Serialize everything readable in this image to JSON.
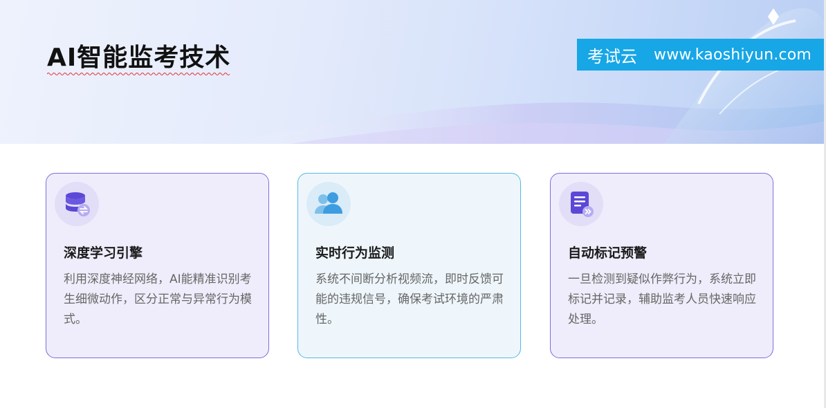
{
  "header": {
    "title": "AI智能监考技术"
  },
  "brand": {
    "name": "考试云",
    "url": "www.kaoshiyun.com",
    "color": "#17a6e6"
  },
  "cards": [
    {
      "icon": "database-sync-icon",
      "title": "深度学习引擎",
      "text": "利用深度神经网络，AI能精准识别考生细微动作，区分正常与异常行为模式。",
      "border_color": "#7a6fdc"
    },
    {
      "icon": "users-icon",
      "title": "实时行为监测",
      "text": "系统不间断分析视频流，即时反馈可能的违规信号，确保考试环境的严肃性。",
      "border_color": "#56b9e3"
    },
    {
      "icon": "document-forward-icon",
      "title": "自动标记预警",
      "text": "一旦检测到疑似作弊行为，系统立即标记并记录，辅助监考人员快速响应处理。",
      "border_color": "#7a6fdc"
    }
  ]
}
